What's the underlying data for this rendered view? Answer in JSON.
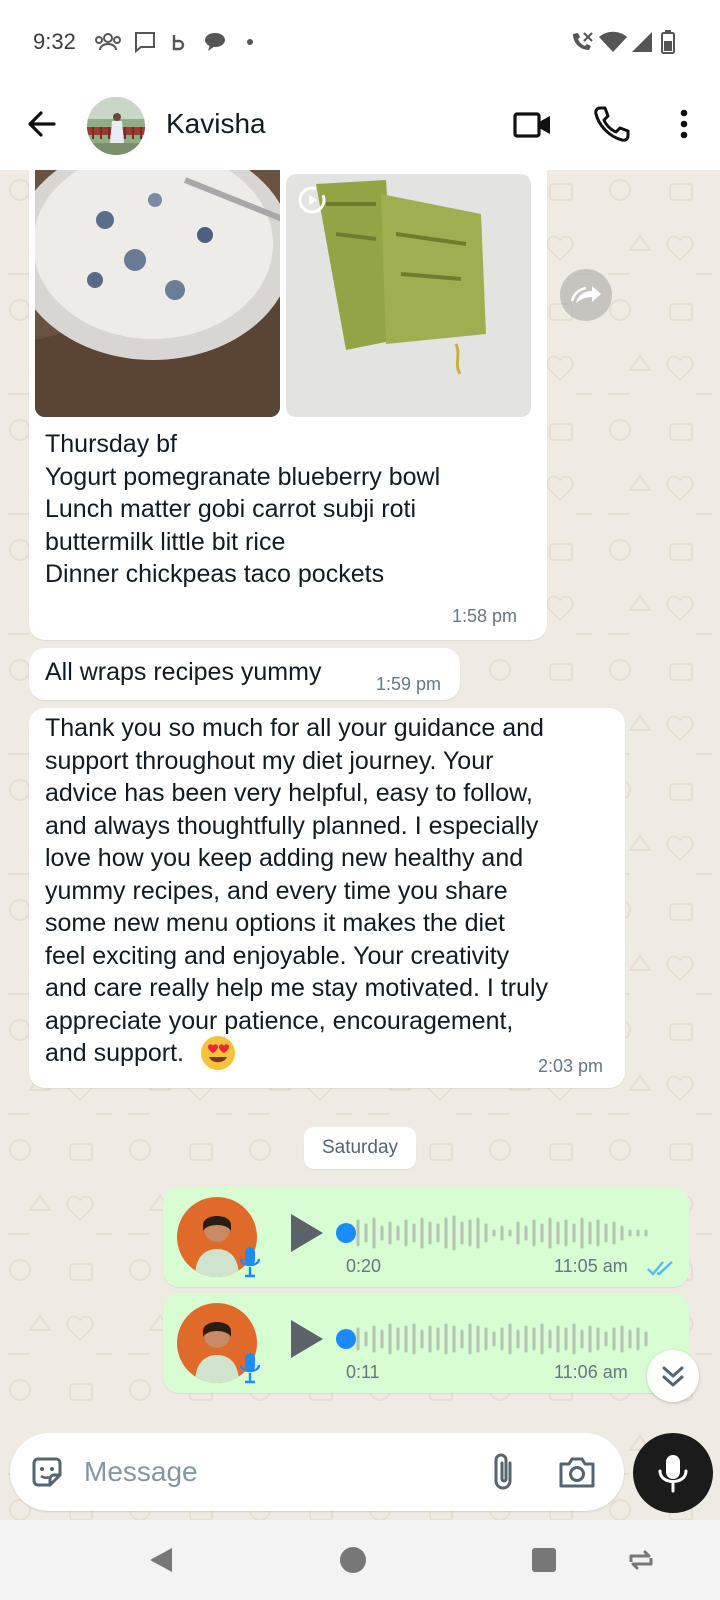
{
  "status_bar": {
    "time": "9:32",
    "left_icons": [
      "group-icon",
      "message-icon",
      "b-icon",
      "chat-bubble-icon",
      "dot-icon"
    ],
    "right_icons": [
      "wifi-call-icon",
      "wifi-icon",
      "signal-icon",
      "battery-icon"
    ]
  },
  "header": {
    "contact_name": "Kavisha",
    "actions": [
      "video-call-icon",
      "voice-call-icon",
      "more-options-icon"
    ]
  },
  "messages": {
    "album": {
      "text": "Thursday bf\nYogurt pomegranate blueberry bowl\nLunch matter gobi carrot subji roti\nbuttermilk little bit rice\nDinner chickpeas taco pockets",
      "time": "1:58 pm"
    },
    "wraps": {
      "text": "All wraps recipes yummy",
      "time": "1:59 pm"
    },
    "thanks": {
      "text": "Thank you so much for all your guidance and\nsupport throughout my diet journey. Your\nadvice has been very helpful, easy to follow,\nand always thoughtfully planned. I especially\nlove how you keep adding new healthy and\nyummy recipes, and every time you share\nsome new menu options it makes the diet\nfeel exciting and enjoyable. Your creativity\nand care really help me stay motivated. I truly\nappreciate your patience, encouragement,\nand support.",
      "emoji": "heart-eyes-emoji",
      "time": "2:03 pm"
    }
  },
  "day_separator": "Saturday",
  "voice_notes": [
    {
      "duration": "0:20",
      "time": "11:05 am",
      "status": "read"
    },
    {
      "duration": "0:11",
      "time": "11:06 am",
      "status": "read"
    }
  ],
  "composer": {
    "placeholder": "Message"
  },
  "colors": {
    "chat_bg": "#efeae2",
    "incoming_bubble": "#ffffff",
    "outgoing_bubble": "#d9fdd3",
    "read_ticks": "#53bdeb",
    "audio_dot": "#1a8cff"
  }
}
